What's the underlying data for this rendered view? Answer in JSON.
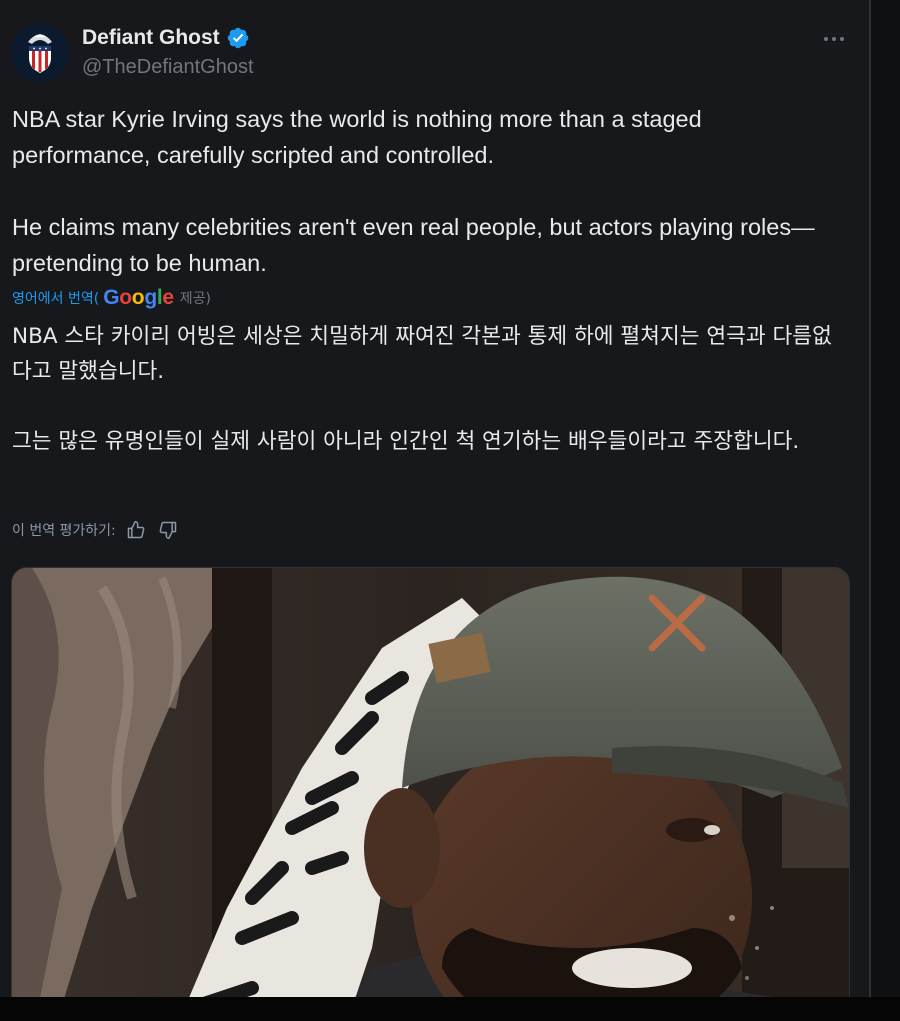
{
  "author": {
    "display_name": "Defiant Ghost",
    "handle": "@TheDefiantGhost",
    "verified": true
  },
  "tweet": {
    "paragraphs": [
      "NBA star Kyrie Irving says the world is nothing more than a staged performance, carefully scripted and controlled.",
      "He claims many celebrities aren't even real people, but actors playing roles—pretending to be human."
    ]
  },
  "translation": {
    "prefix": "영어에서 번역(",
    "provider": "Google",
    "suffix": "제공)",
    "paragraphs": [
      "NBA 스타 카이리 어빙은 세상은 치밀하게 짜여진 각본과 통제 하에 펼쳐지는 연극과 다름없다고 말했습니다.",
      "그는 많은 유명인들이 실제 사람이 아니라 인간인 척 연기하는 배우들이라고 주장합니다."
    ],
    "rate_label": "이 번역 평가하기:"
  },
  "media": {
    "type": "video-still"
  },
  "icons": {
    "verified": "verified-badge-icon",
    "more": "more-options-icon",
    "thumbs_up": "thumbs-up-icon",
    "thumbs_down": "thumbs-down-icon"
  },
  "colors": {
    "background": "#16181c",
    "text": "#e7e9ea",
    "secondary_text": "#71767b",
    "accent": "#1d9bf0"
  }
}
